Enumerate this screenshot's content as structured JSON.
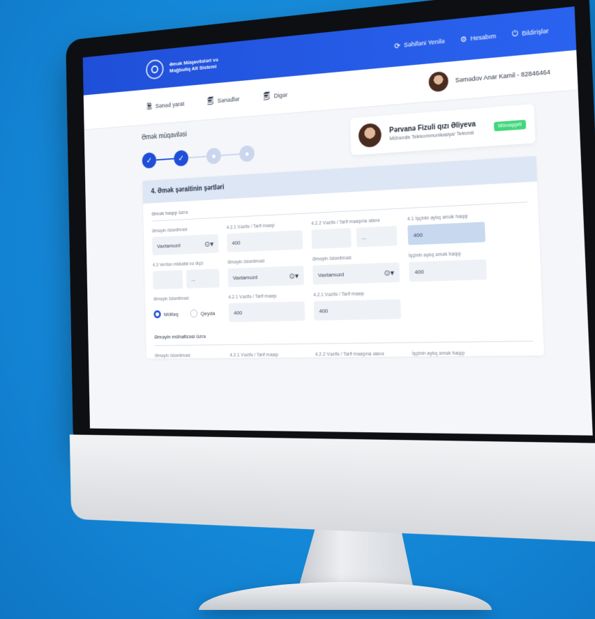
{
  "header": {
    "app_title_line1": "Əmək Müqavilələri və",
    "app_title_line2": "Məğbuliq Alt Sistemi",
    "refresh": "Səhifəni Yenilə",
    "account": "Hesabım",
    "notifications": "Bildirişlər"
  },
  "subnav": {
    "create_doc": "Sənəd yarat",
    "documents": "Sənədlər",
    "other": "Digər",
    "user": "Səmədov Anar Kamil - 82846464"
  },
  "form": {
    "steps_title": "Əmək müqaviləsi",
    "person_name": "Pərvanə Fizuli qızı Əliyeva",
    "person_role": "Mühəndis Telekommunikasiya/ Teleoral",
    "person_badge": "Müvəqqəti",
    "section_title": "4. Əmək şəraitinin şərtləri",
    "sub_label_1": "Əmək haqqı üzrə",
    "sub_label_2": "Əməyin mühafizəsi üzrə",
    "row1": [
      {
        "label": "Əməyin ödənilməsi",
        "value": "Vaxtamuzd"
      },
      {
        "label": "4.2.1   Vəzifə / Tarif maaşı",
        "value": "400"
      },
      {
        "label": "4.2.2   Vəzifə / Tarif maaşına əlavə",
        "value": ""
      },
      {
        "label": "4.1   İşçinin aylıq əmək haqqı",
        "value": "400"
      }
    ],
    "row1_extra": "...",
    "row2": [
      {
        "label": "4.3   Verilən mükafat və ölçü",
        "value": ""
      },
      {
        "label": "Əməyin ödənilməsi",
        "value": "Vaxtamuzd"
      },
      {
        "label": "Əməyin ödənilməsi",
        "value": "Vaxtamuzd"
      },
      {
        "label": "İşçinin aylıq əmək haqqı",
        "value": "400"
      }
    ],
    "row2_extra": "...",
    "row3_label": "Əməyin ödənilməsi",
    "radio_1": "Mütləq",
    "radio_2": "Qeyda",
    "row3": [
      {
        "label": "4.2.1   Vəzifə / Tarif maaşı",
        "value": "400"
      },
      {
        "label": "4.2.1   Vəzifə / Tarif maaşı",
        "value": "400"
      }
    ],
    "row4": [
      {
        "label": "Əməyin ödənilməsi"
      },
      {
        "label": "4.2.1   Vəzifə / Tarif maaşı"
      },
      {
        "label": "4.2.2   Vəzifə / Tarif maaşına əlavə"
      },
      {
        "label": "İşçinin aylıq əmək haqqı"
      }
    ]
  },
  "colors": {
    "primary": "#1f4fd8",
    "background": "#1488d8",
    "badge": "#41d77c"
  }
}
